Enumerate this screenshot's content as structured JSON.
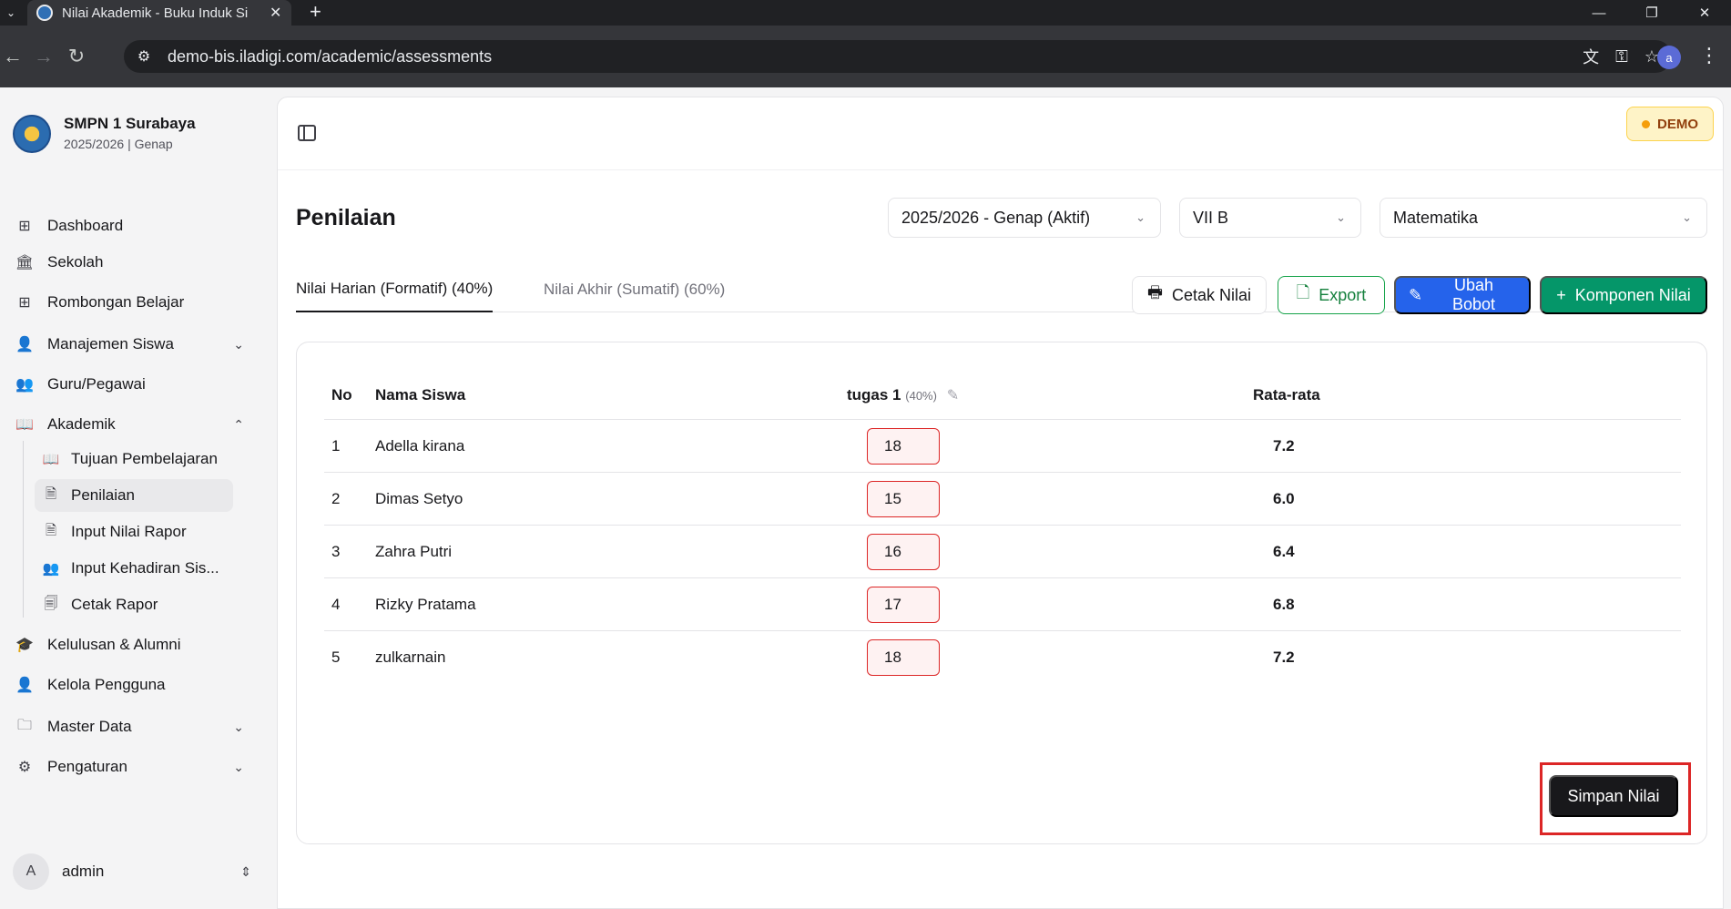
{
  "browser": {
    "tab_title": "Nilai Akademik - Buku Induk Si",
    "url": "demo-bis.iladigi.com/academic/assessments",
    "profile_initial": "a"
  },
  "sidebar": {
    "school_name": "SMPN 1 Surabaya",
    "school_year": "2025/2026 | Genap",
    "items": [
      {
        "label": "Dashboard",
        "icon": "grid-icon"
      },
      {
        "label": "Sekolah",
        "icon": "school-icon"
      },
      {
        "label": "Rombongan Belajar",
        "icon": "grid-icon"
      },
      {
        "label": "Manajemen Siswa",
        "icon": "users-icon"
      },
      {
        "label": "Guru/Pegawai",
        "icon": "users-icon"
      },
      {
        "label": "Akademik",
        "icon": "book-icon"
      },
      {
        "label": "Kelulusan & Alumni",
        "icon": "graduation-cap-icon"
      },
      {
        "label": "Kelola Pengguna",
        "icon": "user-cog-icon"
      },
      {
        "label": "Master Data",
        "icon": "folder-icon"
      },
      {
        "label": "Pengaturan",
        "icon": "gear-icon"
      }
    ],
    "sub_items": [
      {
        "label": "Tujuan Pembelajaran",
        "icon": "book-open-icon"
      },
      {
        "label": "Penilaian",
        "icon": "document-icon"
      },
      {
        "label": "Input Nilai Rapor",
        "icon": "document-icon"
      },
      {
        "label": "Input Kehadiran Sis...",
        "icon": "users-icon"
      },
      {
        "label": "Cetak Rapor",
        "icon": "report-icon"
      }
    ],
    "user": {
      "initial": "A",
      "name": "admin"
    }
  },
  "header": {
    "demo_label": "DEMO"
  },
  "main": {
    "title": "Penilaian",
    "filters": {
      "semester": "2025/2026 - Genap (Aktif)",
      "class": "VII B",
      "subject": "Matematika"
    },
    "tabs": [
      {
        "label": "Nilai Harian (Formatif) (40%)",
        "active": true
      },
      {
        "label": "Nilai Akhir (Sumatif) (60%)",
        "active": false
      }
    ],
    "actions": {
      "print": "Cetak Nilai",
      "export": "Export",
      "edit_weight": "Ubah Bobot",
      "add_component": "Komponen Nilai"
    },
    "table": {
      "headers": {
        "no": "No",
        "name": "Nama Siswa",
        "component": "tugas 1",
        "component_weight": "(40%)",
        "average": "Rata-rata"
      },
      "rows": [
        {
          "no": "1",
          "name": "Adella kirana",
          "score": "18",
          "average": "7.2"
        },
        {
          "no": "2",
          "name": "Dimas Setyo",
          "score": "15",
          "average": "6.0"
        },
        {
          "no": "3",
          "name": "Zahra Putri",
          "score": "16",
          "average": "6.4"
        },
        {
          "no": "4",
          "name": "Rizky Pratama",
          "score": "17",
          "average": "6.8"
        },
        {
          "no": "5",
          "name": "zulkarnain",
          "score": "18",
          "average": "7.2"
        }
      ]
    },
    "save_label": "Simpan Nilai"
  },
  "colors": {
    "primary_blue": "#2563eb",
    "success_green": "#059669",
    "danger_red": "#dc2626",
    "dark": "#18181b"
  }
}
